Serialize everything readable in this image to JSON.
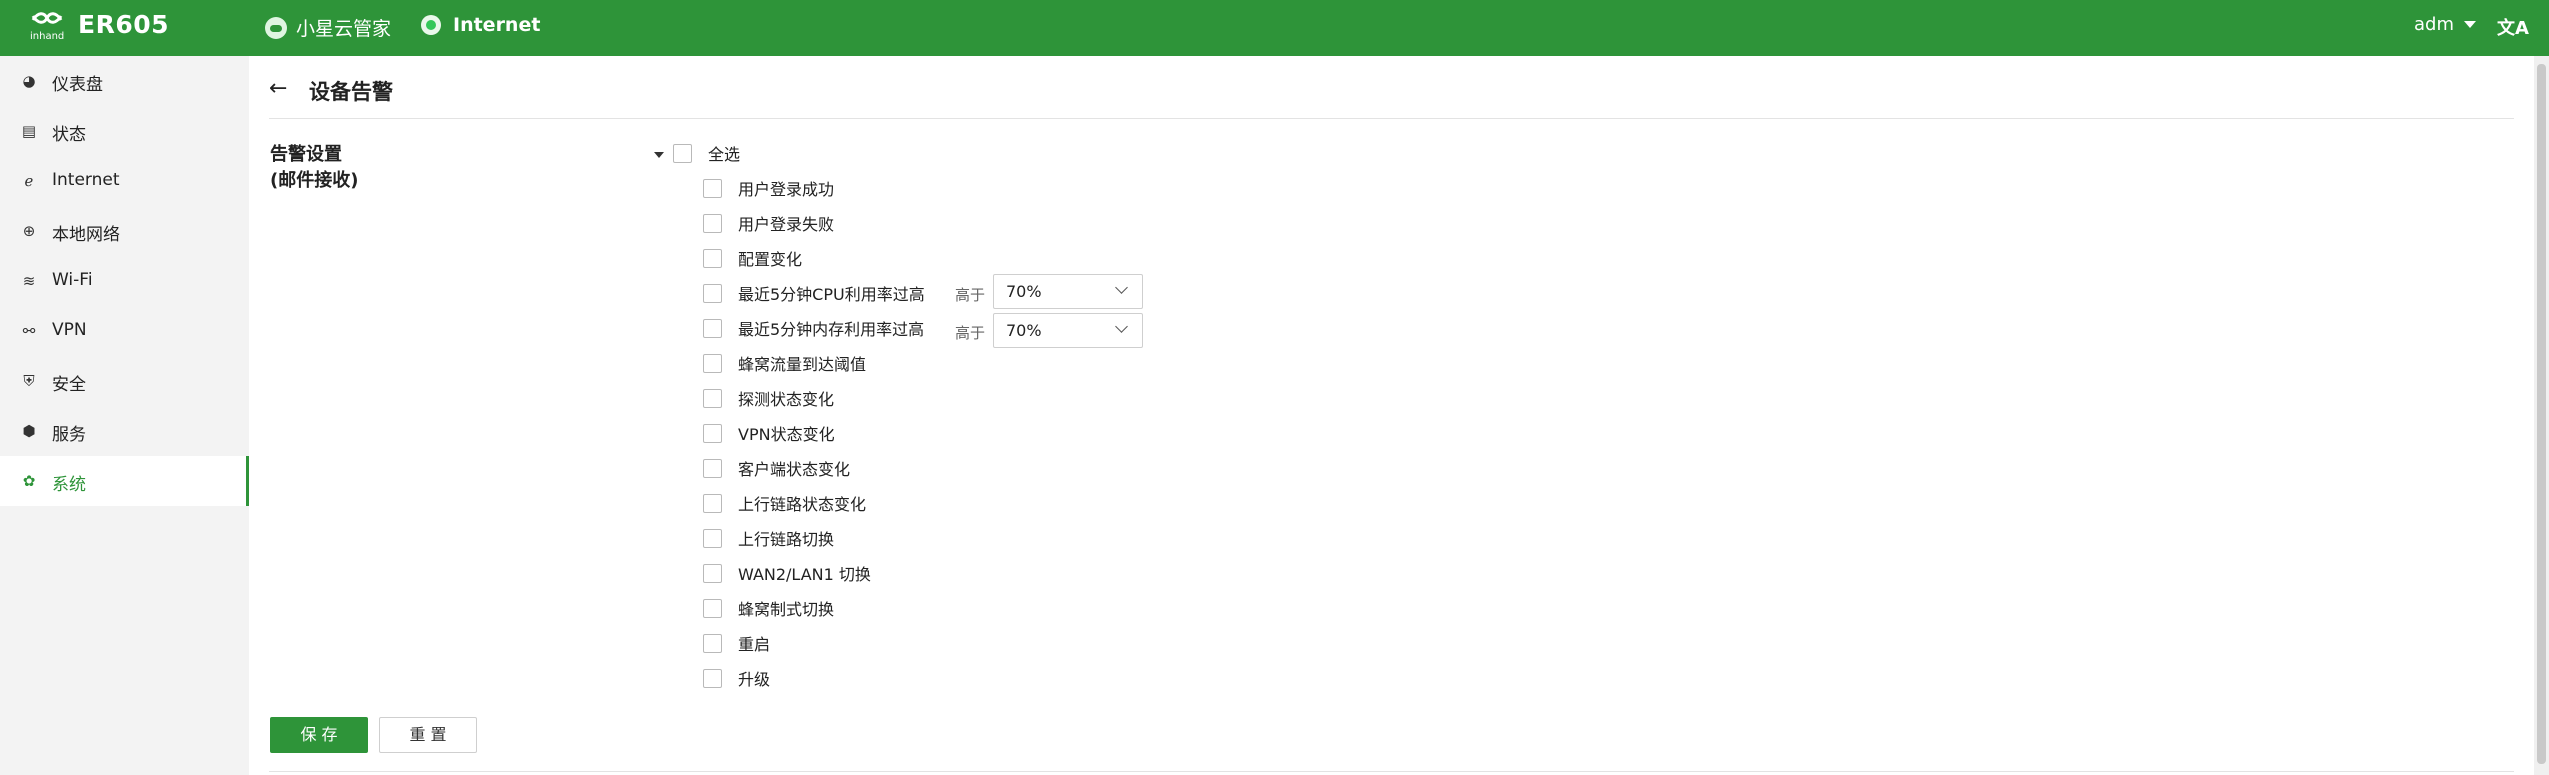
{
  "header": {
    "brand_small": "inhand",
    "model": "ER605",
    "cloud_label": "小星云管家",
    "internet_label": "Internet",
    "user": "adm",
    "lang_icon": "translate-icon",
    "colors": {
      "bar": "#2e9439",
      "accent": "#2e9439"
    }
  },
  "sidebar": {
    "items": [
      {
        "label": "仪表盘",
        "icon": "dashboard-icon"
      },
      {
        "label": "状态",
        "icon": "status-icon"
      },
      {
        "label": "Internet",
        "icon": "internet-icon"
      },
      {
        "label": "本地网络",
        "icon": "globe-icon"
      },
      {
        "label": "Wi-Fi",
        "icon": "wifi-icon"
      },
      {
        "label": "VPN",
        "icon": "vpn-icon"
      },
      {
        "label": "安全",
        "icon": "shield-icon"
      },
      {
        "label": "服务",
        "icon": "cube-icon"
      },
      {
        "label": "系统",
        "icon": "gear-icon",
        "active": true
      }
    ]
  },
  "page": {
    "title": "设备告警",
    "section_line1": "告警设置",
    "section_line2": "(邮件接收)",
    "select_all": "全选",
    "alarms": [
      "用户登录成功",
      "用户登录失败",
      "配置变化",
      "最近5分钟CPU利用率过高",
      "最近5分钟内存利用率过高",
      "蜂窝流量到达阈值",
      "探测状态变化",
      "VPN状态变化",
      "客户端状态变化",
      "上行链路状态变化",
      "上行链路切换",
      "WAN2/LAN1 切换",
      "蜂窝制式切换",
      "重启",
      "升级"
    ],
    "threshold_label": "高于",
    "cpu_threshold": "70%",
    "mem_threshold": "70%",
    "save": "保 存",
    "reset": "重 置"
  }
}
